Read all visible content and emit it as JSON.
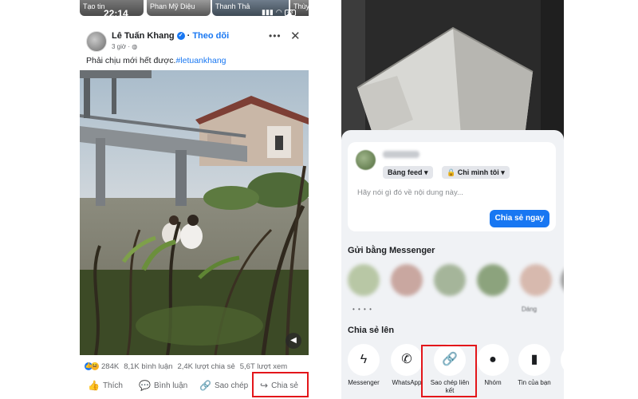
{
  "left": {
    "stories": [
      "Tạo tin",
      "Phan Mỹ Diệu",
      "Thanh Thả",
      "Thùy Lin"
    ],
    "status": {
      "time": "22:14",
      "battery": "43"
    },
    "post": {
      "author": "Lê Tuấn Khang",
      "follow": "Theo dõi",
      "separator": "·",
      "time": "3 giờ · ◍",
      "caption": "Phải chịu mới hết được.",
      "hashtag": "#letuankhang"
    },
    "stats": {
      "reactions": "284K",
      "comments": "8,1K bình luận",
      "shares": "2,4K lượt chia sẻ",
      "views": "5,6T lượt xem"
    },
    "actions": {
      "like": "Thích",
      "comment": "Bình luận",
      "copy": "Sao chép",
      "share": "Chia sẻ"
    }
  },
  "right": {
    "composer": {
      "audience_feed": "Bảng feed ▾",
      "audience_privacy": "🔒 Chỉ mình tôi ▾",
      "placeholder": "Hãy nói gì đó về nội dung này...",
      "share_now": "Chia sẻ ngay"
    },
    "messenger": {
      "title": "Gửi bằng Messenger",
      "visible_labels": [
        "• • • •",
        "Dáng"
      ]
    },
    "share_to": {
      "title": "Chia sẻ lên",
      "apps": [
        {
          "label": "Messenger",
          "icon": "messenger-icon"
        },
        {
          "label": "WhatsApp",
          "icon": "whatsapp-icon"
        },
        {
          "label": "Sao chép liên kết",
          "icon": "link-icon"
        },
        {
          "label": "Nhóm",
          "icon": "group-icon"
        },
        {
          "label": "Tin của bạn",
          "icon": "story-icon"
        }
      ]
    }
  },
  "highlight_color": "#e3161a",
  "accent_color": "#1877f2"
}
